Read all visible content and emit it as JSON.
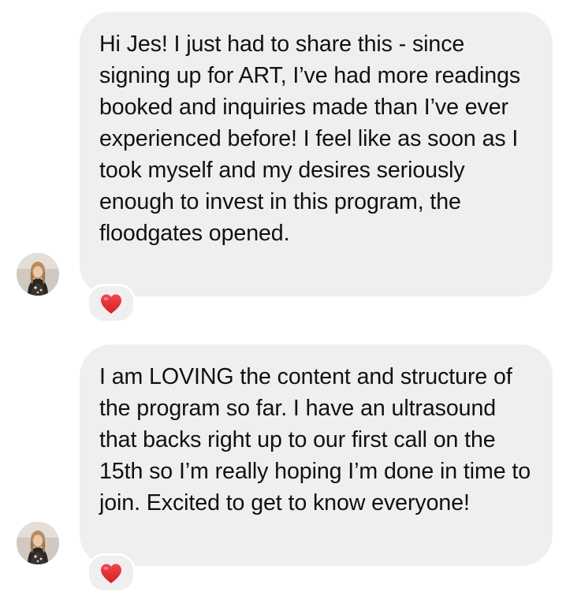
{
  "conversation": {
    "messages": [
      {
        "text": "Hi Jes! I just had to share this - since signing up for ART, I’ve had more readings booked and inquiries made than I’ve ever experienced before! I feel like as soon as I took myself and my desires seriously enough to invest in this program, the floodgates opened.",
        "reaction": "heart-icon"
      },
      {
        "text": "I am LOVING the content and structure of the program so far. I have an ultrasound that backs right up to our first call on the 15th so I’m really hoping I’m done in time to join. Excited to get to know everyone!",
        "reaction": "heart-icon"
      }
    ]
  },
  "colors": {
    "bubble_background": "#efeff0",
    "text": "#111111",
    "heart": "#e0262b"
  }
}
